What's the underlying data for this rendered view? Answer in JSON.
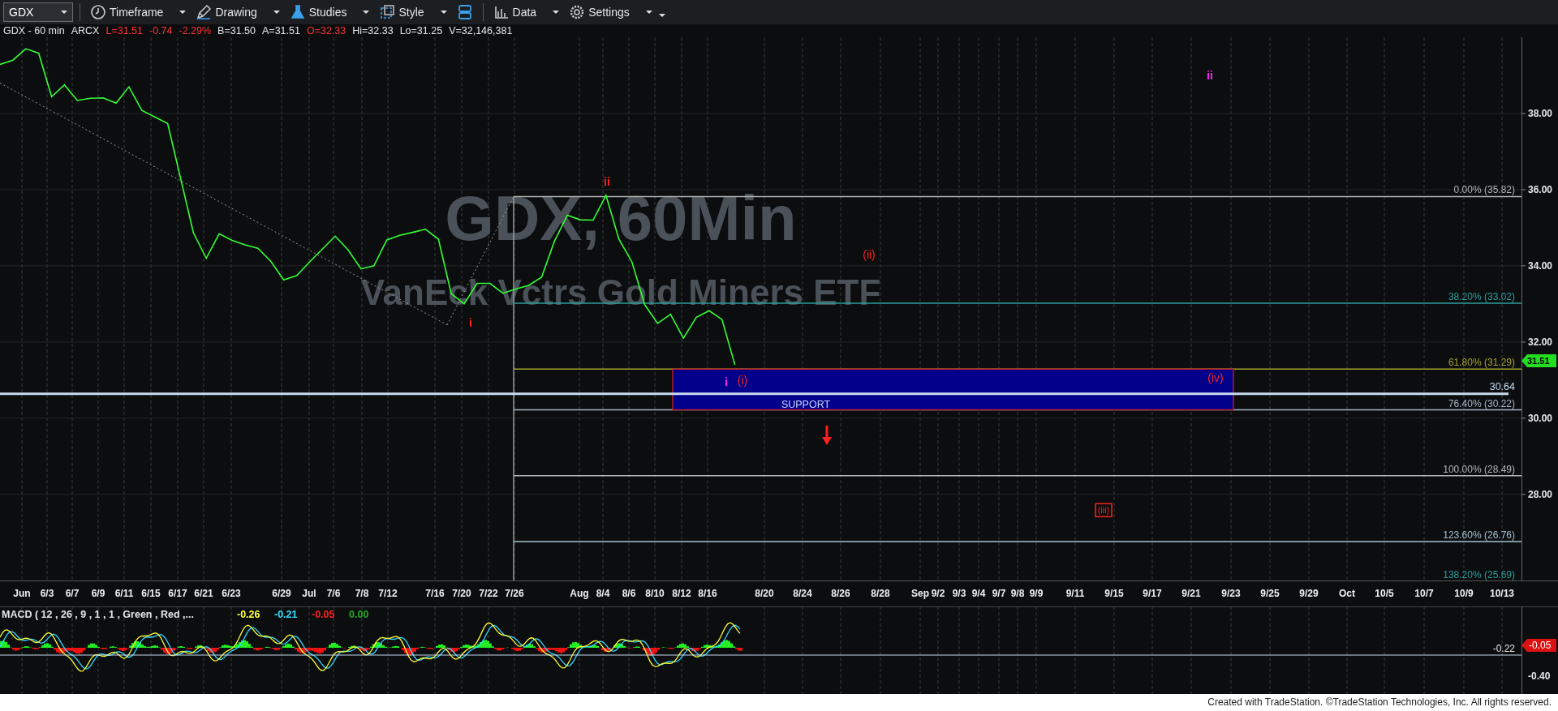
{
  "toolbar": {
    "symbol": "GDX",
    "buttons": [
      {
        "kind": "clock",
        "label": "Timeframe"
      },
      {
        "kind": "pen",
        "label": "Drawing"
      },
      {
        "kind": "flask",
        "label": "Studies"
      },
      {
        "kind": "style",
        "label": "Style"
      },
      {
        "kind": "layout"
      },
      {
        "kind": "bars",
        "label": "Data"
      },
      {
        "kind": "gear",
        "label": "Settings"
      }
    ]
  },
  "info": [
    {
      "text": "GDX - 60 min",
      "color": "#e6e6e6"
    },
    {
      "text": "ARCX",
      "color": "#e6e6e6"
    },
    {
      "text": "L=31.51",
      "color": "#ff3333"
    },
    {
      "text": "-0.74",
      "color": "#ff3333"
    },
    {
      "text": "-2.29%",
      "color": "#ff3333"
    },
    {
      "text": "B=31.50",
      "color": "#e6e6e6"
    },
    {
      "text": "A=31.51",
      "color": "#e6e6e6"
    },
    {
      "text": "O=32.33",
      "color": "#ff3333"
    },
    {
      "text": "Hi=32.33",
      "color": "#e6e6e6"
    },
    {
      "text": "Lo=31.25",
      "color": "#e6e6e6"
    },
    {
      "text": "V=32,146,381",
      "color": "#e6e6e6"
    }
  ],
  "price_panel": {
    "watermark": [
      "GDX, 60Min",
      "VanEck Vctrs Gold Miners ETF"
    ],
    "price_tag": "31.51",
    "fib_levels": [
      {
        "text": "0.00% (35.82)",
        "color": "#b4b4b4"
      },
      {
        "text": "38.20% (33.02)",
        "color": "#2e9c9c"
      },
      {
        "text": "61.80% (31.29)",
        "color": "#a4a42c"
      },
      {
        "text": "76.40% (30.22)",
        "color": "#a8b8c8"
      },
      {
        "text": "100.00% (28.49)",
        "color": "#b4b4b4"
      },
      {
        "text": "123.60% (26.76)",
        "color": "#a8c0d0"
      },
      {
        "text": "138.20% (25.69)",
        "color": "#2e9c9c"
      }
    ],
    "support_zone": {
      "text": "SUPPORT"
    },
    "wave_labels": [
      {
        "text": "i",
        "color": "#ff2020",
        "boxed": false
      },
      {
        "text": "ii",
        "color": "#ff2020",
        "boxed": false
      },
      {
        "text": "(ii)",
        "color": "#ff2020",
        "boxed": false
      },
      {
        "text": "i",
        "color": "#ff22ff",
        "boxed": false
      },
      {
        "text": "(i)",
        "color": "#ff2020",
        "boxed": false
      },
      {
        "text": "(iv)",
        "color": "#ff2020",
        "boxed": false
      },
      {
        "text": "ii",
        "color": "#ff22ff",
        "boxed": false
      },
      {
        "text": "(iii)",
        "color": "#ff2020",
        "boxed": true
      }
    ],
    "chart_data": {
      "type": "line",
      "grid": true,
      "ylim": [
        25.74,
        40.0
      ],
      "categories": [
        null,
        null,
        "Jun",
        null,
        "6/3",
        null,
        "6/7",
        null,
        "6/9",
        null,
        "6/11",
        null,
        "6/15",
        null,
        "6/17",
        null,
        "6/21",
        null,
        "6/23",
        null,
        null,
        null,
        "6/29",
        null,
        "Jul",
        null,
        "7/6",
        null,
        "7/8",
        null,
        "7/12",
        null,
        null,
        null,
        "7/16",
        null,
        "7/20",
        null,
        "7/22",
        null,
        "7/26",
        null,
        null,
        null,
        null,
        "Aug",
        null,
        "8/4",
        null,
        "8/6",
        null,
        "8/10",
        null,
        "8/12",
        null,
        "8/16",
        null,
        null,
        null,
        "8/20",
        null,
        null,
        "8/24",
        null,
        null,
        "8/26",
        null,
        null,
        "8/28",
        null,
        null,
        "Sep",
        null,
        "9/2",
        "9/3",
        null,
        "9/4",
        "9/7",
        null,
        "9/8",
        "9/9",
        null,
        null,
        "9/11",
        null,
        null,
        "9/15",
        null,
        null,
        "9/17",
        null,
        null,
        "9/21",
        null,
        null,
        "9/23",
        null,
        null,
        "9/25",
        null,
        null,
        null,
        "9/29",
        null,
        "Oct",
        null,
        null,
        "10/5",
        null,
        null,
        "10/7",
        null,
        null,
        null,
        "10/9",
        null,
        "10/13",
        null
      ],
      "yticks": [
        {
          "value": 28,
          "label": "28.00"
        },
        {
          "value": 30,
          "label": "30.00"
        },
        {
          "value": 32,
          "label": "32.00"
        },
        {
          "value": 34,
          "label": "34.00"
        },
        {
          "value": 36,
          "label": "36.00"
        },
        {
          "value": 38,
          "label": "38.00"
        }
      ],
      "series": [
        {
          "color": "#33ff33",
          "values": [
            39.29,
            39.4,
            39.7,
            39.58,
            38.44,
            38.75,
            38.34,
            38.4,
            38.41,
            38.27,
            38.7,
            38.08,
            37.91,
            37.74,
            36.3,
            34.87,
            34.2,
            34.84,
            34.67,
            34.55,
            34.46,
            34.12,
            33.63,
            33.74,
            34.1,
            34.44,
            34.78,
            34.42,
            33.92,
            34.0,
            34.68,
            34.8,
            34.88,
            34.96,
            34.7,
            33.27,
            33.0,
            33.54,
            33.54,
            33.28,
            33.39,
            33.49,
            33.7,
            34.65,
            35.33,
            35.21,
            35.2,
            35.85,
            34.7,
            34.11,
            32.98,
            32.49,
            32.73,
            32.1,
            32.65,
            32.82,
            32.59,
            31.4,
            null,
            null,
            null,
            null,
            null,
            null,
            null,
            null,
            null,
            null,
            null,
            null,
            null,
            null,
            null,
            null,
            null,
            null,
            null,
            null,
            null,
            null,
            null,
            null,
            null,
            null,
            null,
            null,
            null,
            null,
            null,
            null,
            null,
            null,
            null,
            null,
            null,
            null,
            null,
            null,
            null,
            null,
            null,
            null,
            null,
            null,
            null,
            null,
            null,
            null,
            null,
            null,
            null,
            null,
            null,
            null,
            null,
            null,
            null,
            null
          ]
        },
        {
          "name": "30.64",
          "color": "#c8dcf0",
          "values": [
            30.64,
            30.64,
            30.64,
            30.64,
            30.64,
            30.64,
            30.64,
            30.64,
            30.64,
            30.64,
            30.64,
            30.64,
            30.64,
            30.64,
            30.64,
            30.64,
            30.64,
            30.64,
            30.64,
            30.64,
            30.64,
            30.64,
            30.64,
            30.64,
            30.64,
            30.64,
            30.64,
            30.64,
            30.64,
            30.64,
            30.64,
            30.64,
            30.64,
            30.64,
            30.64,
            30.64,
            30.64,
            30.64,
            30.64,
            30.64,
            30.64,
            30.64,
            30.64,
            30.64,
            30.64,
            30.64,
            30.64,
            30.64,
            30.64,
            30.64,
            30.64,
            30.64,
            30.64,
            30.64,
            30.64,
            30.64,
            30.64,
            30.64,
            30.64,
            30.64,
            30.64,
            30.64,
            30.64,
            30.64,
            30.64,
            30.64,
            30.64,
            30.64,
            30.64,
            30.64,
            30.64,
            30.64,
            30.64,
            30.64,
            30.64,
            30.64,
            30.64,
            30.64,
            30.64,
            30.64,
            30.64,
            30.64,
            30.64,
            30.64,
            30.64,
            30.64,
            30.64,
            30.64,
            30.64,
            30.64,
            30.64,
            30.64,
            30.64,
            30.64,
            30.64,
            30.64,
            30.64,
            30.64,
            30.64,
            30.64,
            30.64,
            30.64,
            30.64,
            30.64,
            30.64,
            30.64,
            30.64,
            30.64,
            30.64,
            30.64,
            30.64,
            30.64,
            30.64,
            30.64,
            30.64,
            30.64,
            30.64,
            30.64
          ]
        }
      ]
    }
  },
  "macd_panel": {
    "title": "MACD ( 12 , 26 , 9 , 1 , 1 , Green , Red ,...",
    "values": [
      {
        "text": "-0.26",
        "color": "#ffff33"
      },
      {
        "text": "-0.21",
        "color": "#33e0ff"
      },
      {
        "text": "-0.05",
        "color": "#ff2222"
      },
      {
        "text": "0.00",
        "color": "#22aa22"
      }
    ],
    "reference_label": "-0.22",
    "axis_label": "-0.40",
    "tag": "-0.05"
  },
  "footer": "Created with TradeStation. ©TradeStation Technologies, Inc. All rights reserved."
}
